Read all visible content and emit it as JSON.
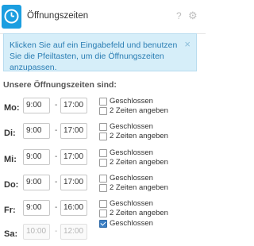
{
  "header": {
    "title": "Öffnungszeiten",
    "help_icon": "?",
    "settings_icon": "⚙"
  },
  "info": {
    "text": "Klicken Sie auf ein Eingabefeld und benutzen Sie die Pfeiltasten, um die Öffnungszeiten anzupassen.",
    "close": "×"
  },
  "section_title": "Unsere Öffnungszeiten sind:",
  "days": [
    {
      "label": "Mo:",
      "from": "9:00",
      "to": "17:00",
      "closed_label": "Geschlossen",
      "two_times_label": "2 Zeiten angeben",
      "closed": false
    },
    {
      "label": "Di:",
      "from": "9:00",
      "to": "17:00",
      "closed_label": "Geschlossen",
      "two_times_label": "2 Zeiten angeben",
      "closed": false
    },
    {
      "label": "Mi:",
      "from": "9:00",
      "to": "17:00",
      "closed_label": "Geschlossen",
      "two_times_label": "2 Zeiten angeben",
      "closed": false
    },
    {
      "label": "Do:",
      "from": "9:00",
      "to": "17:00",
      "closed_label": "Geschlossen",
      "two_times_label": "2 Zeiten angeben",
      "closed": false
    },
    {
      "label": "Fr:",
      "from": "9:00",
      "to": "16:00",
      "closed_label": "Geschlossen",
      "two_times_label": "2 Zeiten angeben",
      "closed": false
    },
    {
      "label": "Sa:",
      "from": "10:00",
      "to": "12:00",
      "closed_label": "Geschlossen",
      "closed": true
    }
  ],
  "time_separator": "-",
  "colors": {
    "accent": "#1b9ee0",
    "info_bg": "#d6eef9",
    "info_text": "#2a7db3"
  }
}
